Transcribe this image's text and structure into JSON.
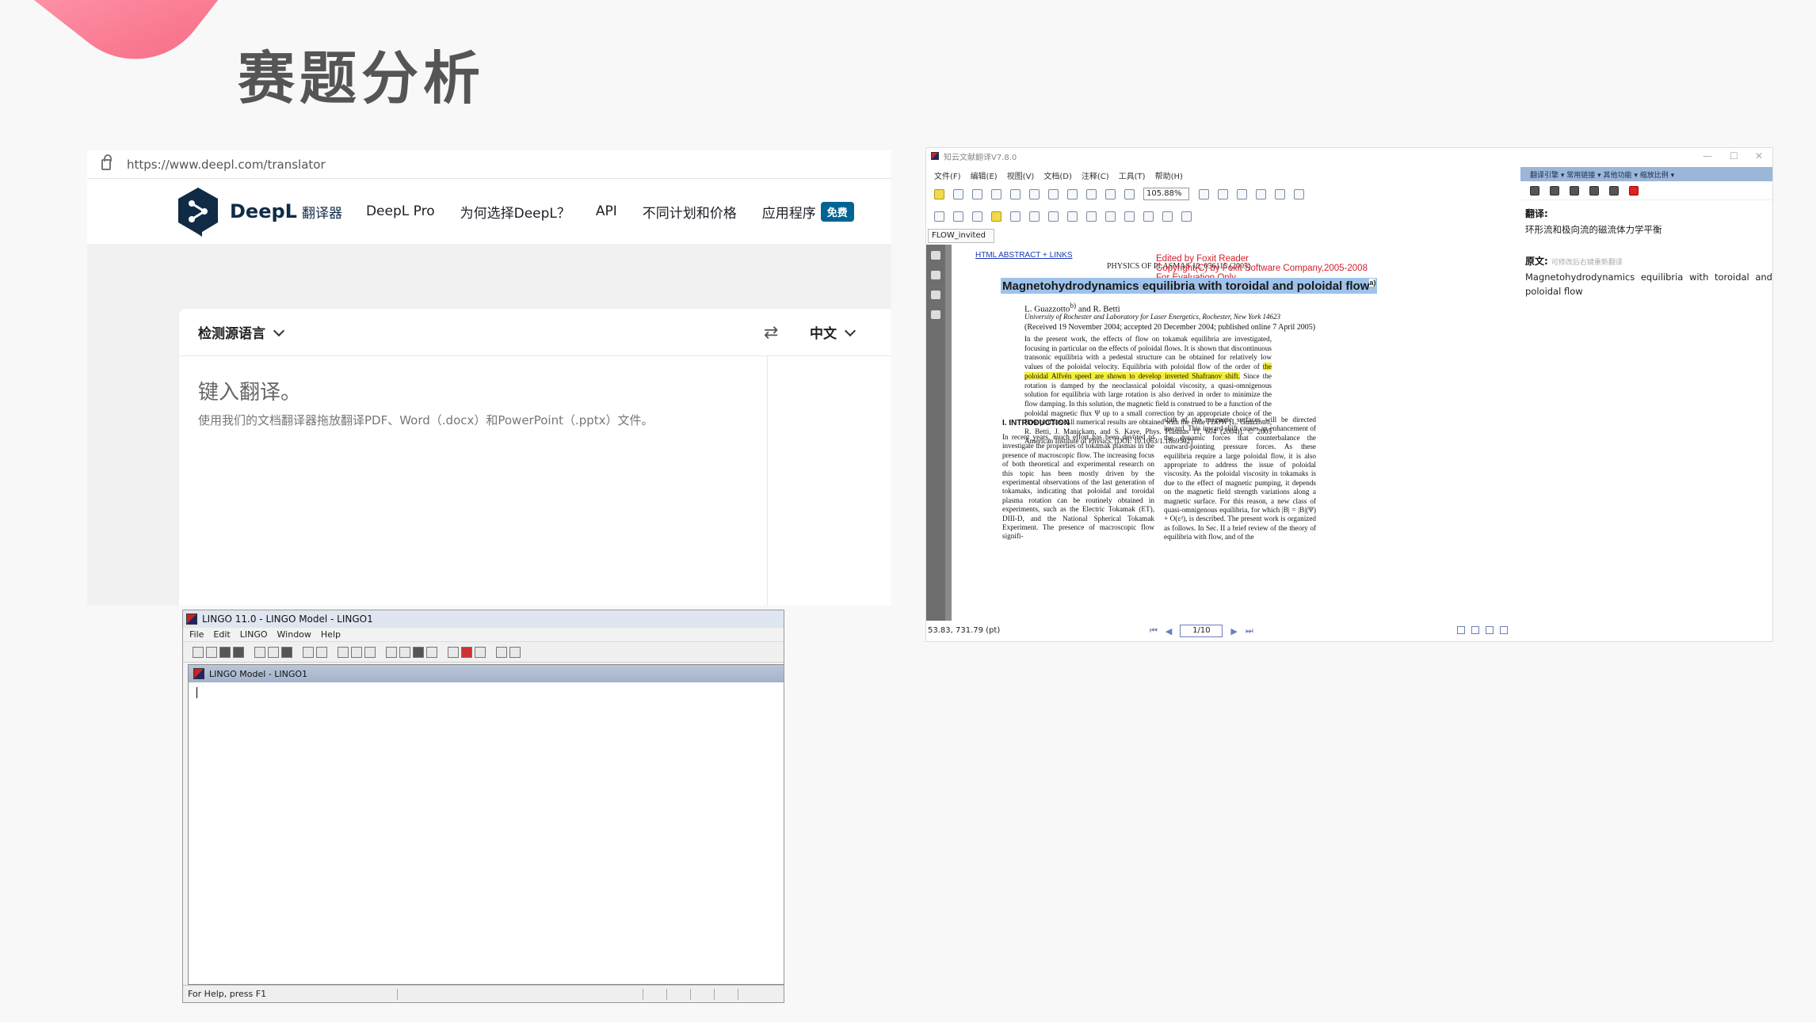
{
  "slide": {
    "title": "赛题分析"
  },
  "deepl": {
    "url": "https://www.deepl.com/translator",
    "brand": "DeepL",
    "brand_sub": "翻译器",
    "nav": [
      "DeepL Pro",
      "为何选择DeepL？",
      "API",
      "不同计划和价格",
      "应用程序"
    ],
    "badge": "免费",
    "source_lang": "检测源语言",
    "target_lang": "中文",
    "placeholder": "键入翻译。",
    "hint": "使用我们的文档翻译器拖放翻译PDF、Word（.docx）和PowerPoint（.pptx）文件。",
    "colors": {
      "brand": "#0f2b46",
      "badge": "#006494"
    }
  },
  "lingo": {
    "title": "LINGO 11.0 - LINGO Model - LINGO1",
    "menu": [
      "File",
      "Edit",
      "LINGO",
      "Window",
      "Help"
    ],
    "child_title": "LINGO Model - LINGO1",
    "status": "For Help, press F1"
  },
  "foxit": {
    "title": "知云文献翻译V7.8.0",
    "menu": [
      "文件(F)",
      "编辑(E)",
      "视图(V)",
      "文档(D)",
      "注释(C)",
      "工具(T)",
      "帮助(H)"
    ],
    "zoom": "105.88%",
    "tab": "FLOW_invited",
    "coords": "53.83, 731.79 (pt)",
    "page": "1/10",
    "doc": {
      "link": "HTML ABSTRACT + LINKS",
      "journal": "PHYSICS OF PLASMAS 12, 056115 (2005)",
      "edited": [
        "Edited by Foxit Reader",
        "Copyright(C) by Foxit Software Company,2005-2008",
        "For Evaluation Only."
      ],
      "title": "Magnetohydrodynamics equilibria with toroidal and poloidal flow",
      "title_sup": "a)",
      "authors": "L. Guazzotto",
      "authors_sup": "b)",
      "authors_rest": " and R. Betti",
      "affiliation": "University of Rochester and Laboratory for Laser Energetics, Rochester, New York 14623",
      "received": "(Received 19 November 2004; accepted 20 December 2004; published online 7 April 2005)",
      "abstract_pre": "In the present work, the effects of flow on tokamak equilibria are investigated, focusing in particular on the effects of poloidal flows. It is shown that discontinuous transonic equilibria with a pedestal structure can be obtained for relatively low values of the poloidal velocity. Equilibria with poloidal flow of the order of ",
      "abstract_hl": "the poloidal Alfvén speed are shown to develop inverted Shafranov shift.",
      "abstract_post": " Since the rotation is damped by the neoclassical poloidal viscosity, a quasi-omnigenous solution for equilibria with large rotation is also derived in order to minimize the flow damping. In this solution, the magnetic field is construed to be a function of the poloidal magnetic flux Ψ up to a small correction by an appropriate choice of the flow profiles. All numerical results are obtained with the code FLOW [L. Guazzotto, R. Betti, J. Manickam, and S. Kaye, Phys. Plasmas 11, 604 (2004)]. © 2005 American Institute of Physics. [DOI: 10.1063/1.1869502]",
      "section": "I. INTRODUCTION",
      "col1": "In recent years, much effort has been devoted to investigate the properties of tokamak plasmas in the presence of macroscopic flow. The increasing focus of both theoretical and experimental research on this topic has been mostly driven by the experimental observations of the last generation of tokamaks, indicating that poloidal and toroidal plasma rotation can be routinely obtained in experiments, such as the Electric Tokamak (ET), DIII-D, and the National Spherical Tokamak Experiment. The presence of macroscopic flow signifi-",
      "col2": "shift of the magnetic surfaces will be directed inward. This inward shift causes an enhancement of the dynamic forces that counterbalance the outward-pointing pressure forces. As these equilibria require a large poloidal flow, it is also appropriate to address the issue of poloidal viscosity. As the poloidal viscosity in tokamaks is due to the effect of magnetic pumping, it depends on the magnetic field strength variations along a magnetic surface. For this reason, a new class of quasi-omnigenous equilibria, for which |B| = |B|(Ψ) + O(ε²), is described. The present work is organized as follows. In Sec. II a brief review of the theory of equilibria with flow, and of the"
    },
    "panel": {
      "bar": "翻译引擎 ▾  常用链接 ▾  其他功能 ▾  缩放比例 ▾",
      "translation_label": "翻译:",
      "translation": "环形流和极向流的磁流体力学平衡",
      "source_label": "原文:",
      "source_note": "可修改后右键重新翻译",
      "source": "Magnetohydrodynamics equilibria with toroidal and poloidal flow"
    }
  }
}
